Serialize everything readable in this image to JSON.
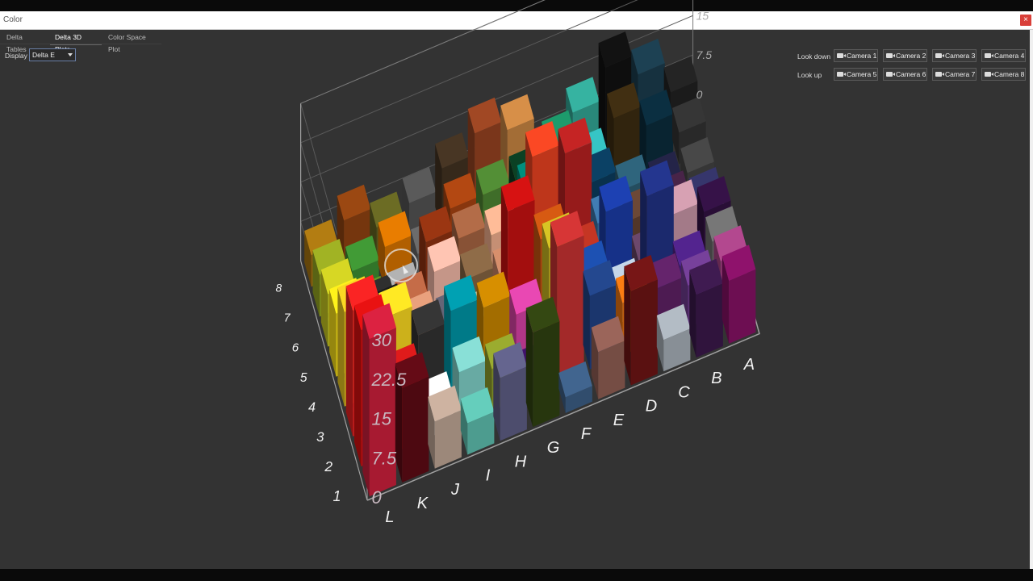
{
  "window": {
    "title": "Color",
    "close_glyph": "×"
  },
  "tabs": [
    "Delta Tables",
    "Delta 3D Plots",
    "Color Space Plot"
  ],
  "active_tab": 1,
  "display": {
    "label": "Display",
    "value": "Delta E"
  },
  "cameras": {
    "look_down_label": "Look down",
    "look_up_label": "Look up",
    "look_down": [
      "Camera 1",
      "Camera 2",
      "Camera 3",
      "Camera 4"
    ],
    "look_up": [
      "Camera 5",
      "Camera 6",
      "Camera 7",
      "Camera 8"
    ]
  },
  "chart_data": {
    "type": "bar3d",
    "z_ticks": [
      "0",
      "7.5",
      "15",
      "22.5",
      "30"
    ],
    "x_categories": [
      "L",
      "K",
      "J",
      "I",
      "H",
      "G",
      "F",
      "E",
      "D",
      "C",
      "B",
      "A"
    ],
    "y_categories": [
      "1",
      "2",
      "3",
      "4",
      "5",
      "6",
      "7",
      "8"
    ],
    "colors": {
      "background": "#333333",
      "axis": "#a0a0a0"
    }
  }
}
